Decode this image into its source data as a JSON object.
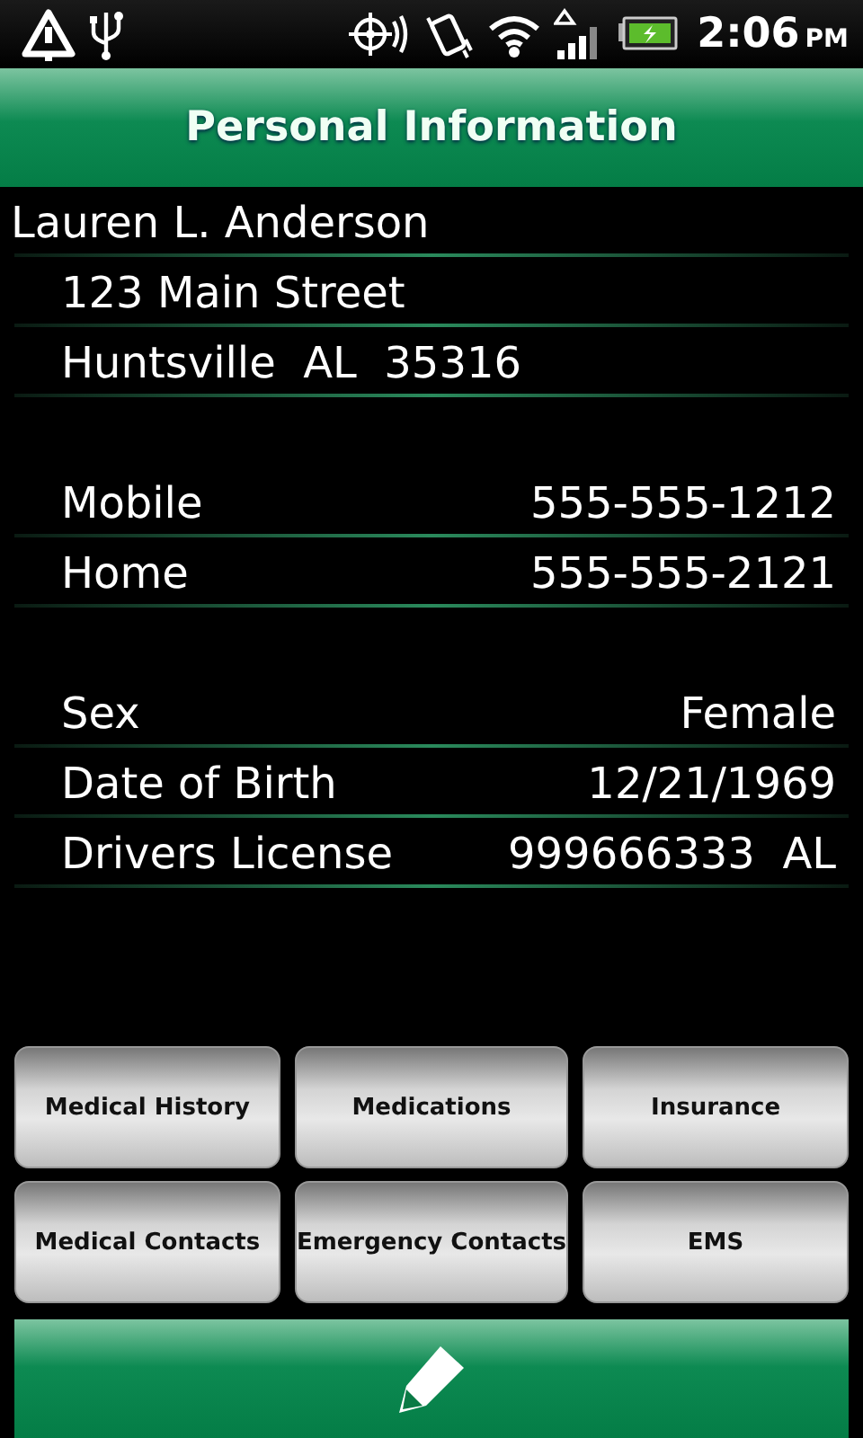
{
  "status_bar": {
    "time": "2:06",
    "ampm": "PM"
  },
  "title": "Personal Information",
  "name": "Lauren L. Anderson",
  "address": [
    "123 Main Street",
    "Huntsville  AL  35316"
  ],
  "sections": [
    {
      "rows": [
        {
          "label": "Mobile",
          "value": "555-555-1212"
        },
        {
          "label": "Home",
          "value": "555-555-2121"
        }
      ]
    },
    {
      "rows": [
        {
          "label": "Sex",
          "value": "Female"
        },
        {
          "label": "Date of Birth",
          "value": "12/21/1969"
        },
        {
          "label": "Drivers License",
          "value": "999666333  AL"
        }
      ]
    }
  ],
  "buttons": [
    "Medical History",
    "Medications",
    "Insurance",
    "Medical Contacts",
    "Emergency Contacts",
    "EMS"
  ]
}
